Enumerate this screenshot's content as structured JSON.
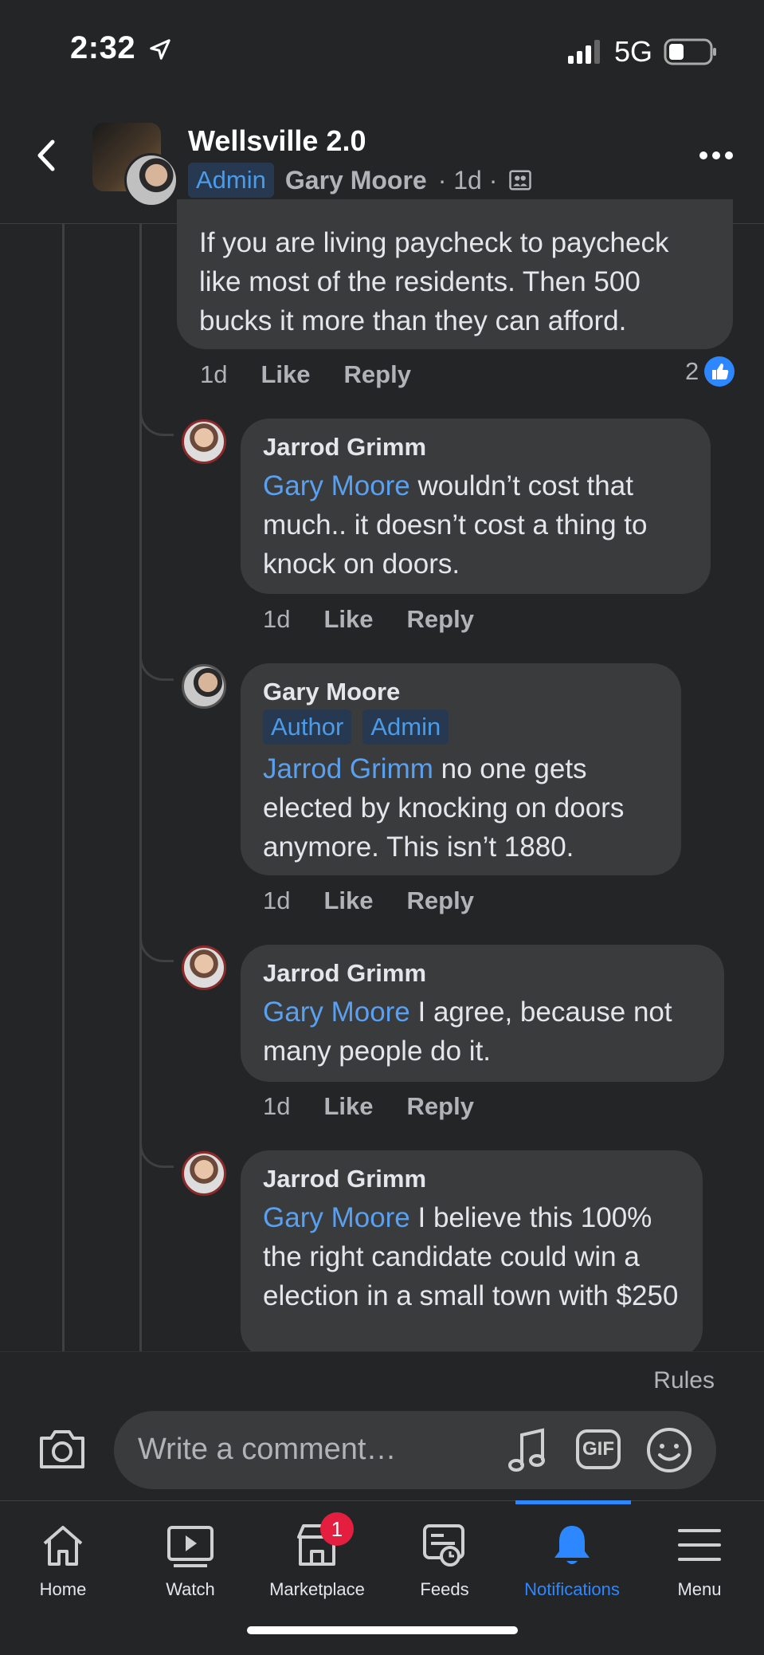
{
  "status_bar": {
    "time": "2:32",
    "network": "5G"
  },
  "header": {
    "group_name": "Wellsville 2.0",
    "role_badge": "Admin",
    "author": "Gary Moore",
    "age": "· 1d ·"
  },
  "comments": [
    {
      "text": "If you are living paycheck to paycheck like most of the residents. Then 500 bucks it more than they can afford.",
      "time": "1d",
      "like": "Like",
      "reply": "Reply",
      "reactions": "2"
    },
    {
      "author": "Jarrod Grimm",
      "mention": "Gary Moore",
      "text": " wouldn’t cost that much.. it doesn’t cost a thing to knock on doors.",
      "time": "1d",
      "like": "Like",
      "reply": "Reply"
    },
    {
      "author": "Gary Moore",
      "badges": [
        "Author",
        "Admin"
      ],
      "mention": "Jarrod Grimm",
      "text": " no one gets elected by knocking on doors anymore. This isn’t 1880.",
      "time": "1d",
      "like": "Like",
      "reply": "Reply"
    },
    {
      "author": "Jarrod Grimm",
      "mention": "Gary Moore",
      "text": " I agree, because not many people do it.",
      "time": "1d",
      "like": "Like",
      "reply": "Reply"
    },
    {
      "author": "Jarrod Grimm",
      "mention": "Gary Moore",
      "text": " I believe this 100% the right candidate could win a election in a small town with $250",
      "time": "",
      "like": "",
      "reply": ""
    }
  ],
  "composer": {
    "rules": "Rules",
    "placeholder": "Write a comment…",
    "gif": "GIF"
  },
  "tabs": [
    {
      "label": "Home",
      "icon": "home-icon"
    },
    {
      "label": "Watch",
      "icon": "watch-icon"
    },
    {
      "label": "Marketplace",
      "icon": "marketplace-icon",
      "badge": "1"
    },
    {
      "label": "Feeds",
      "icon": "feeds-icon"
    },
    {
      "label": "Notifications",
      "icon": "bell-icon",
      "active": true
    },
    {
      "label": "Menu",
      "icon": "menu-icon"
    }
  ],
  "colors": {
    "background": "#242526",
    "bubble": "#3a3b3c",
    "accent": "#2d88ff",
    "mention": "#5aa0f0"
  }
}
